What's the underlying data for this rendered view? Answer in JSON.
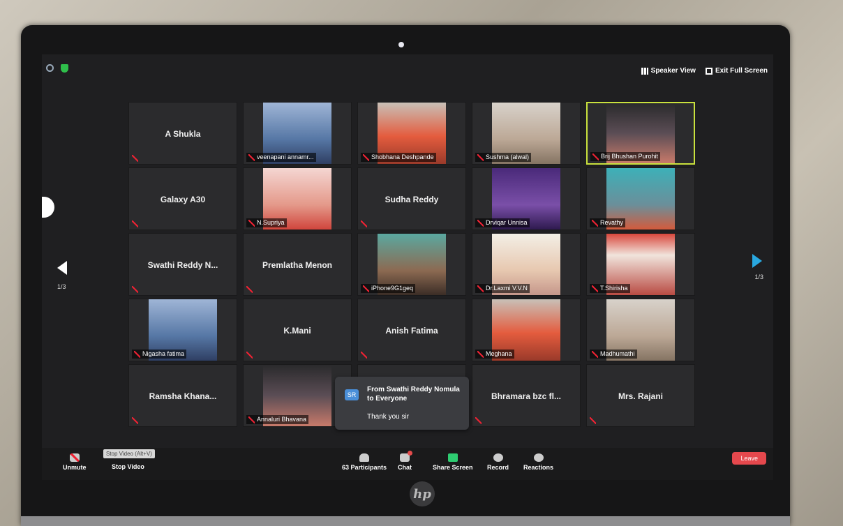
{
  "window": {
    "speaker_view_label": "Speaker View",
    "exit_full_screen_label": "Exit Full Screen",
    "page_left": "1/3",
    "page_right": "1/3"
  },
  "tiles": [
    {
      "name": "A Shukla",
      "has_video": false
    },
    {
      "name": "veenapani annamr...",
      "has_video": true
    },
    {
      "name": "Shobhana Deshpande",
      "has_video": true
    },
    {
      "name": "Sushma (alwal)",
      "has_video": true
    },
    {
      "name": "Brij Bhushan Purohit",
      "has_video": true,
      "active_speaker": true
    },
    {
      "name": "Galaxy A30",
      "has_video": false
    },
    {
      "name": "N.Supriya",
      "has_video": true
    },
    {
      "name": "Sudha Reddy",
      "has_video": false
    },
    {
      "name": "Drviqar Unnisa",
      "has_video": true
    },
    {
      "name": "Revathy",
      "has_video": true
    },
    {
      "name": "Swathi Reddy N...",
      "has_video": false
    },
    {
      "name": "Premlatha Menon",
      "has_video": false
    },
    {
      "name": "iPhone9G1geq",
      "has_video": true
    },
    {
      "name": "Dr.Laxmi V.V.N",
      "has_video": true
    },
    {
      "name": "T.Shirisha",
      "has_video": true
    },
    {
      "name": "Nigasha fatima",
      "has_video": true
    },
    {
      "name": "K.Mani",
      "has_video": false
    },
    {
      "name": "Anish Fatima",
      "has_video": false
    },
    {
      "name": "Meghana",
      "has_video": true
    },
    {
      "name": "Madhumathi",
      "has_video": true
    },
    {
      "name": "Ramsha Khana...",
      "has_video": false
    },
    {
      "name": "Annaluri Bhavana",
      "has_video": true
    },
    {
      "name": "",
      "has_video": false
    },
    {
      "name": "Bhramara bzc fl...",
      "has_video": false
    },
    {
      "name": "Mrs. Rajani",
      "has_video": false
    }
  ],
  "chat_popup": {
    "avatar_initials": "SR",
    "from": "From Swathi Reddy Nomula to Everyone",
    "message": "Thank you sir"
  },
  "toolbar": {
    "unmute_label": "Unmute",
    "stop_video_label": "Stop Video",
    "stop_video_tooltip": "Stop Video (Alt+V)",
    "participants_count": "63",
    "participants_label": "Participants",
    "chat_label": "Chat",
    "share_screen_label": "Share Screen",
    "record_label": "Record",
    "reactions_label": "Reactions",
    "leave_label": "Leave"
  },
  "brand": {
    "laptop_logo": "hp"
  },
  "colors": {
    "share_green": "#2ecc71",
    "leave_red": "#e5484d",
    "active_border": "#c9e13d",
    "next_arrow": "#29a8e0"
  }
}
